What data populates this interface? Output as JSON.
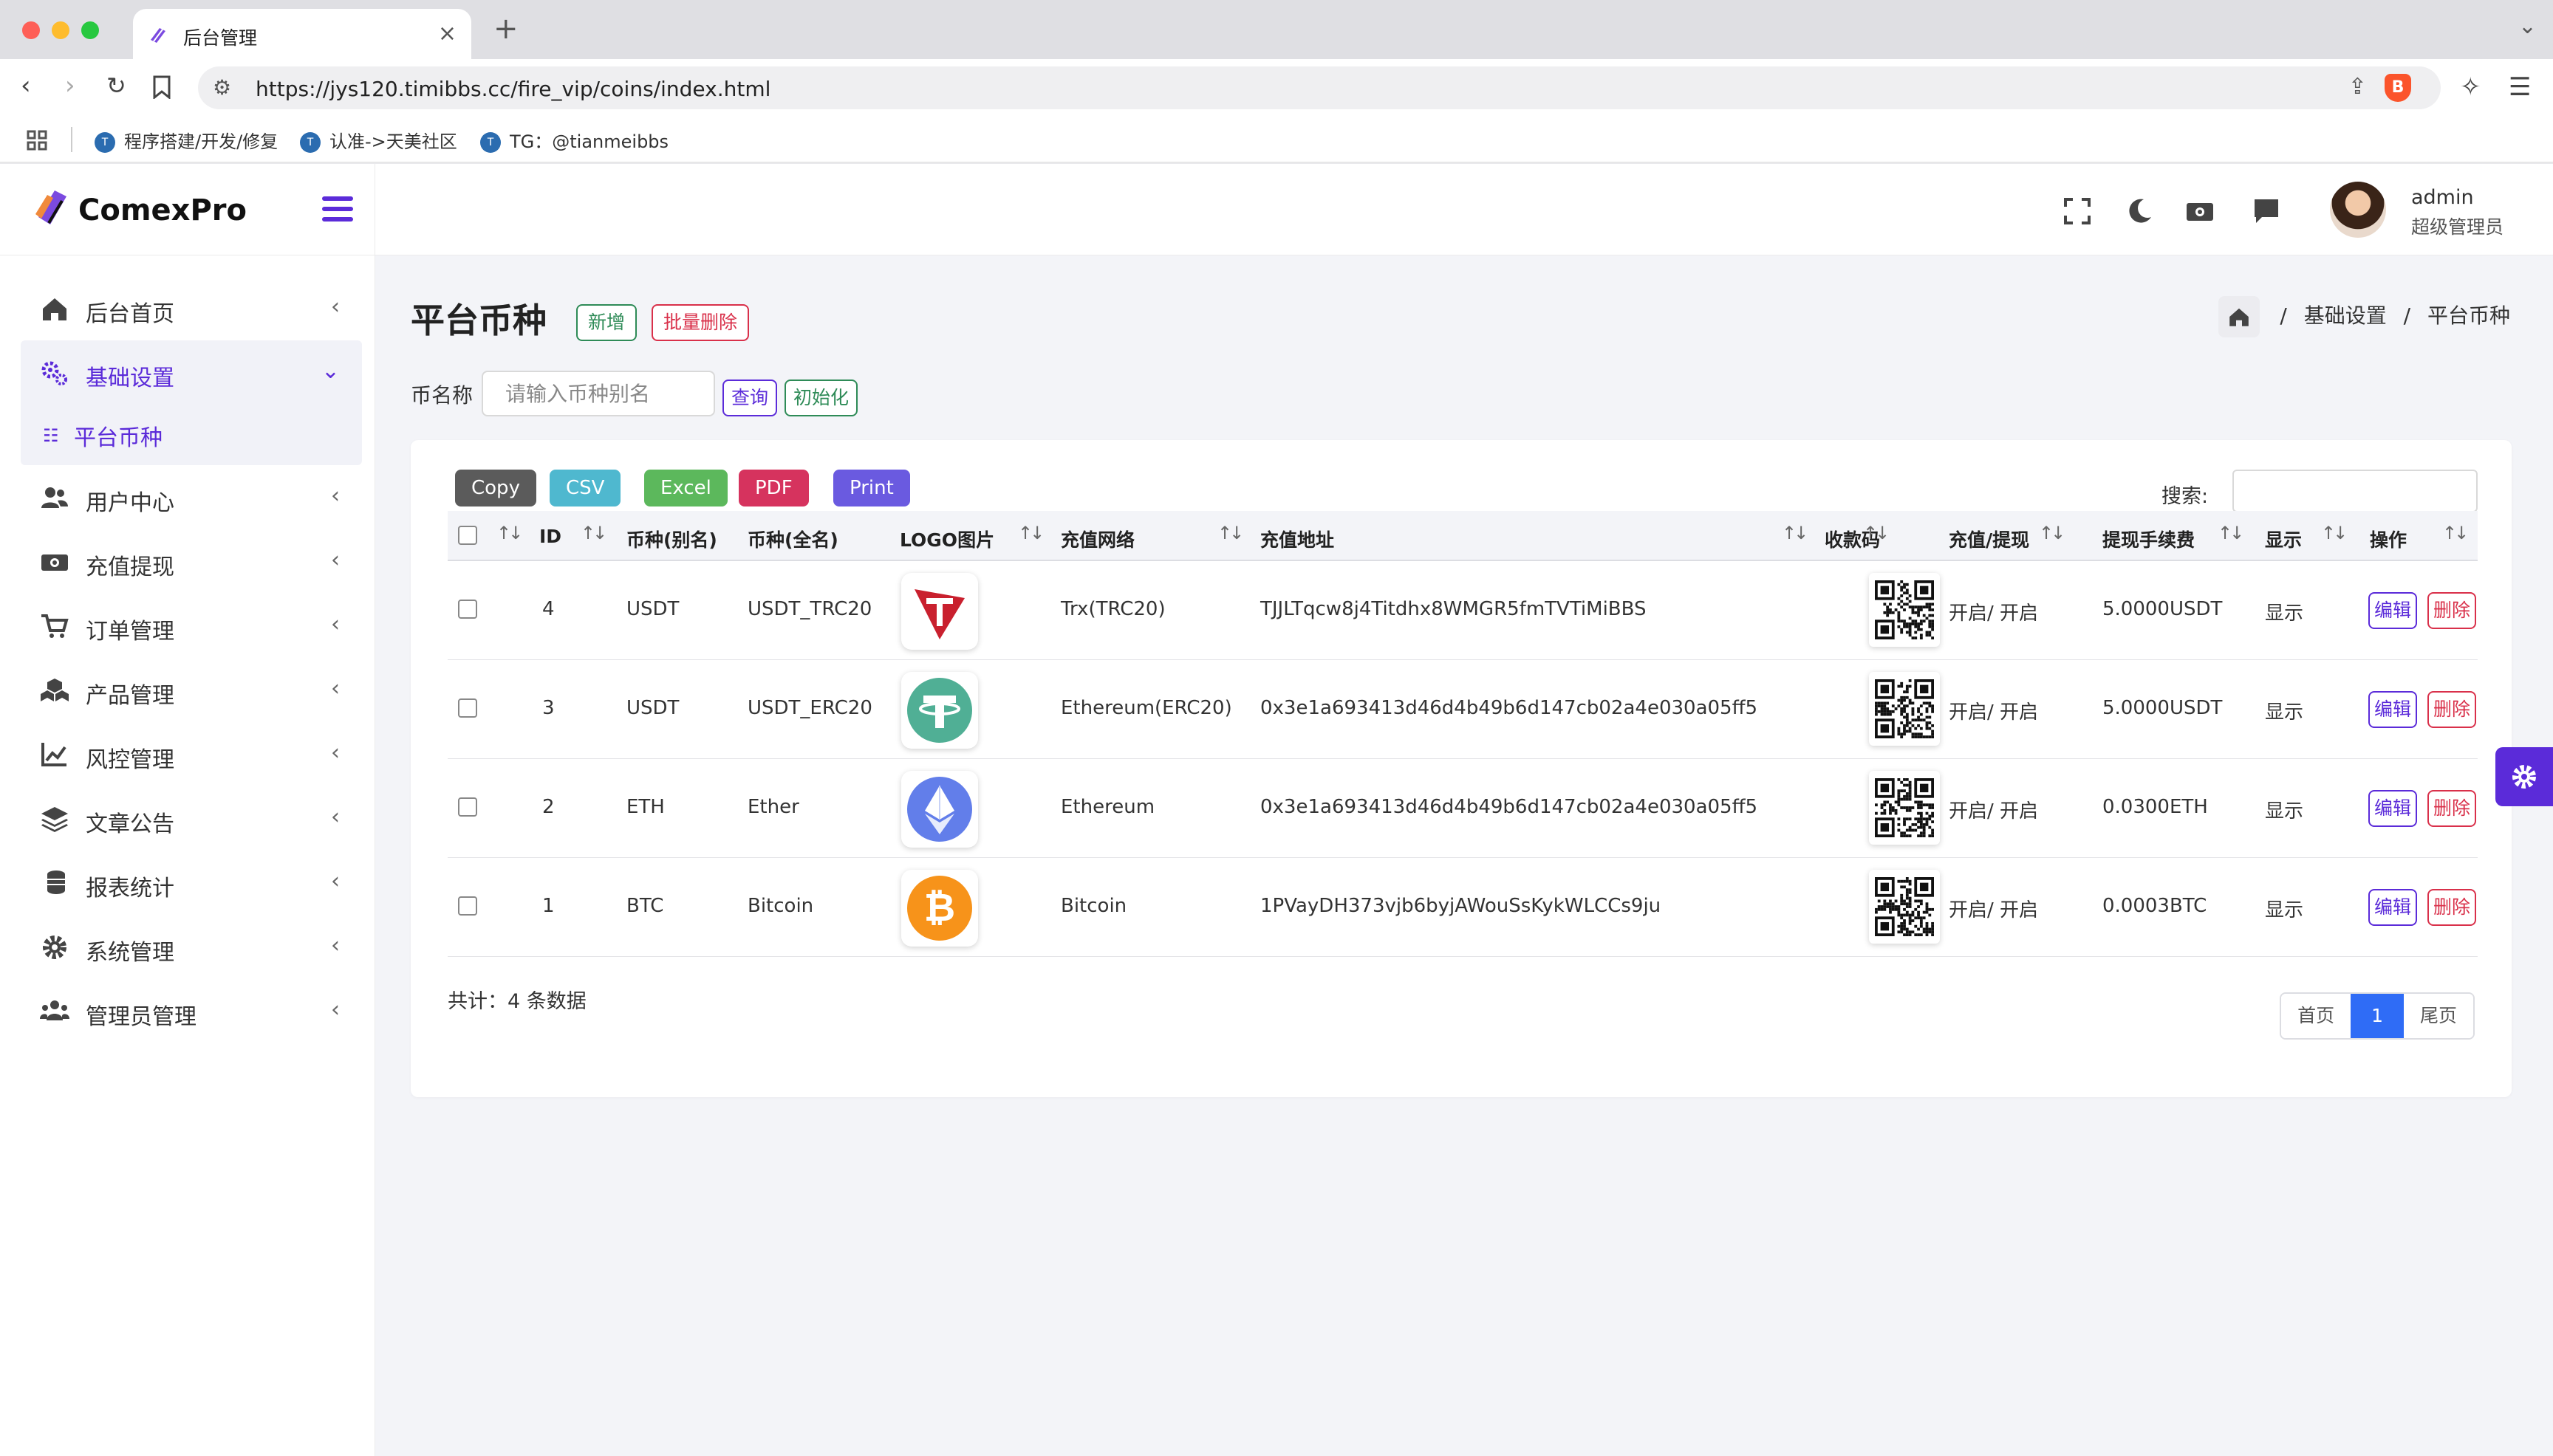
{
  "browser": {
    "tab_title": "后台管理",
    "url": "https://jys120.timibbs.cc/fire_vip/coins/index.html",
    "bookmarks": [
      "程序搭建/开发/修复",
      "认准->天美社区",
      "TG：@tianmeibbs"
    ]
  },
  "brand": {
    "name": "ComexPro"
  },
  "sidebar": {
    "items": [
      {
        "label": "后台首页",
        "icon": "home-icon"
      },
      {
        "label": "基础设置",
        "icon": "gears-icon",
        "open": true,
        "sub": [
          {
            "label": "平台币种"
          }
        ]
      },
      {
        "label": "用户中心",
        "icon": "users-icon"
      },
      {
        "label": "充值提现",
        "icon": "money-icon"
      },
      {
        "label": "订单管理",
        "icon": "cart-icon"
      },
      {
        "label": "产品管理",
        "icon": "cubes-icon"
      },
      {
        "label": "风控管理",
        "icon": "chart-line-icon"
      },
      {
        "label": "文章公告",
        "icon": "layers-icon"
      },
      {
        "label": "报表统计",
        "icon": "coins-icon"
      },
      {
        "label": "系统管理",
        "icon": "gear-icon"
      },
      {
        "label": "管理员管理",
        "icon": "user-group-icon"
      }
    ]
  },
  "user": {
    "name": "admin",
    "role": "超级管理员"
  },
  "page": {
    "title": "平台币种",
    "add_label": "新增",
    "batch_delete_label": "批量删除",
    "breadcrumb": [
      "基础设置",
      "平台币种"
    ],
    "breadcrumb_sep": "/"
  },
  "filter": {
    "label": "币名称",
    "placeholder": "请输入币种别名",
    "query_label": "查询",
    "init_label": "初始化"
  },
  "table": {
    "export_buttons": [
      {
        "label": "Copy",
        "color": "#5b5b5b"
      },
      {
        "label": "CSV",
        "color": "#4fb8cf"
      },
      {
        "label": "Excel",
        "color": "#5cb85c"
      },
      {
        "label": "PDF",
        "color": "#d6335e"
      },
      {
        "label": "Print",
        "color": "#6a5ae0"
      }
    ],
    "search_label": "搜索:",
    "headers": [
      "ID",
      "币种(别名)",
      "币种(全名)",
      "LOGO图片",
      "充值网络",
      "充值地址",
      "收款码",
      "充值/提现",
      "提现手续费",
      "显示",
      "操作"
    ],
    "rows": [
      {
        "id": "4",
        "alias": "USDT",
        "full": "USDT_TRC20",
        "logo": "tron",
        "network": "Trx(TRC20)",
        "address": "TJJLTqcw8j4Titdhx8WMGR5fmTVTiMiBBS",
        "status": "开启/ 开启",
        "fee": "5.0000USDT",
        "display": "显示"
      },
      {
        "id": "3",
        "alias": "USDT",
        "full": "USDT_ERC20",
        "logo": "tether",
        "network": "Ethereum(ERC20)",
        "address": "0x3e1a693413d46d4b49b6d147cb02a4e030a05ff5",
        "status": "开启/ 开启",
        "fee": "5.0000USDT",
        "display": "显示"
      },
      {
        "id": "2",
        "alias": "ETH",
        "full": "Ether",
        "logo": "ethereum",
        "network": "Ethereum",
        "address": "0x3e1a693413d46d4b49b6d147cb02a4e030a05ff5",
        "status": "开启/ 开启",
        "fee": "0.0300ETH",
        "display": "显示"
      },
      {
        "id": "1",
        "alias": "BTC",
        "full": "Bitcoin",
        "logo": "bitcoin",
        "network": "Bitcoin",
        "address": "1PVayDH373vjb6byjAWouSsKykWLCCs9ju",
        "status": "开启/ 开启",
        "fee": "0.0003BTC",
        "display": "显示"
      }
    ],
    "edit_label": "编辑",
    "delete_label": "删除",
    "total_text": "共计：4 条数据",
    "pager": {
      "first": "首页",
      "current": "1",
      "last": "尾页"
    }
  },
  "colors": {
    "accent": "#5b2bd9",
    "pager_active": "#2f6cf6"
  }
}
